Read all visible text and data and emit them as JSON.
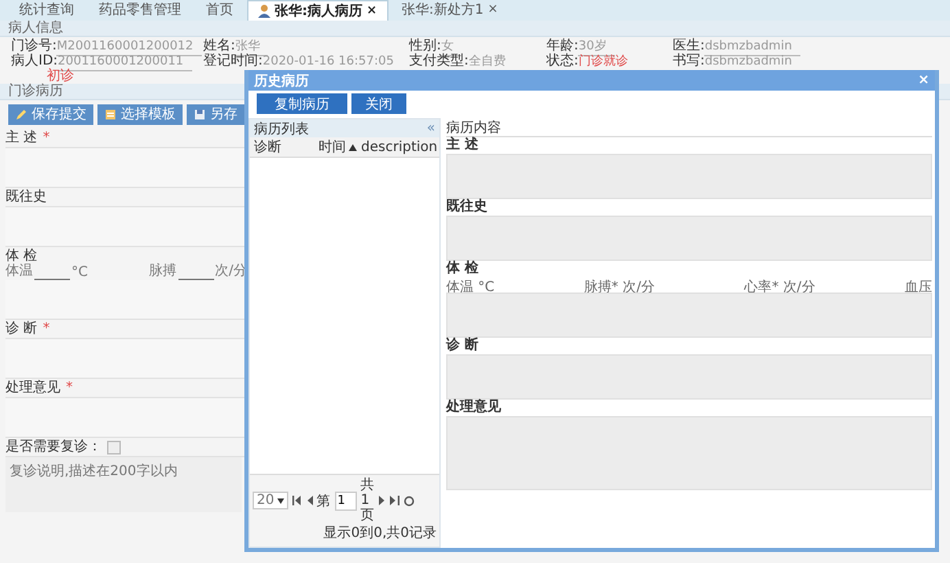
{
  "tabs": [
    {
      "label": "统计查询",
      "selected": false,
      "closable": false,
      "kind": "page"
    },
    {
      "label": "药品零售管理",
      "selected": false,
      "closable": false,
      "kind": "page"
    },
    {
      "label": "首页",
      "selected": false,
      "closable": false,
      "kind": "page"
    },
    {
      "label": "张华:病人病历",
      "selected": true,
      "closable": true,
      "kind": "patient",
      "close": "×"
    },
    {
      "label": "张华:新处方1",
      "selected": false,
      "closable": true,
      "kind": "page",
      "close": "×"
    }
  ],
  "patient_panel": {
    "title": "病人信息",
    "fields": [
      {
        "label": "门诊号:",
        "value": "M2001160001200012",
        "alert": false
      },
      {
        "label": "姓名:",
        "value": "张华",
        "alert": false
      },
      {
        "label": "性别:",
        "value": "女",
        "alert": false
      },
      {
        "label": "年龄:",
        "value": "30岁",
        "alert": false
      },
      {
        "label": "医生:",
        "value": "dsbmzbadmin",
        "alert": false
      },
      {
        "label": "病人ID:",
        "value": "2001160001200011",
        "alert": false
      },
      {
        "label": "登记时间:",
        "value": "2020-01-16 16:57:05",
        "alert": false
      },
      {
        "label": "支付类型:",
        "value": "全自费",
        "alert": false
      },
      {
        "label": "状态:",
        "value": "门诊就诊",
        "alert": true
      },
      {
        "label": "书写:",
        "value": "dsbmzbadmin",
        "alert": false
      }
    ],
    "visit_type": "初诊"
  },
  "record_panel": {
    "title": "门诊病历",
    "toolbar": [
      "保存提交",
      "选择模板",
      "另存"
    ],
    "sections": [
      {
        "kind": "text",
        "label": "主 述",
        "mark": "*"
      },
      {
        "kind": "text",
        "label": "既往史"
      },
      {
        "kind": "exam",
        "label": "体 检",
        "vitals": [
          {
            "label": "体温",
            "unit": "°C"
          },
          {
            "label": "脉搏",
            "unit": "次/分"
          }
        ]
      },
      {
        "kind": "text",
        "label": "诊 断",
        "mark": "*"
      },
      {
        "kind": "text",
        "label": "处理意见",
        "mark": "*"
      },
      {
        "kind": "followup",
        "label": "是否需要复诊：",
        "checked": false,
        "placeholder": "复诊说明,描述在200字以内"
      }
    ]
  },
  "dialog": {
    "title": "历史病历",
    "close": "×",
    "buttons": [
      "复制病历",
      "关闭"
    ],
    "list_panel": {
      "title": "病历列表",
      "collapse": "«",
      "columns": [
        {
          "label": "诊断",
          "sorted": false
        },
        {
          "label": "时间",
          "sorted": true
        },
        {
          "label": "description",
          "sorted": false
        }
      ],
      "pager": {
        "page_size": "20",
        "page_prefix": "第",
        "page": "1",
        "page_total": "共1页",
        "summary": "显示0到0,共0记录"
      }
    },
    "content_panel": {
      "title": "病历内容",
      "sections": [
        {
          "label": "主 述"
        },
        {
          "label": "既往史"
        },
        {
          "label": "体 检",
          "vitals": [
            "体温 °C",
            "脉搏* 次/分",
            "心率* 次/分",
            "血压"
          ]
        },
        {
          "label": "诊 断"
        },
        {
          "label": "处理意见"
        }
      ]
    }
  }
}
